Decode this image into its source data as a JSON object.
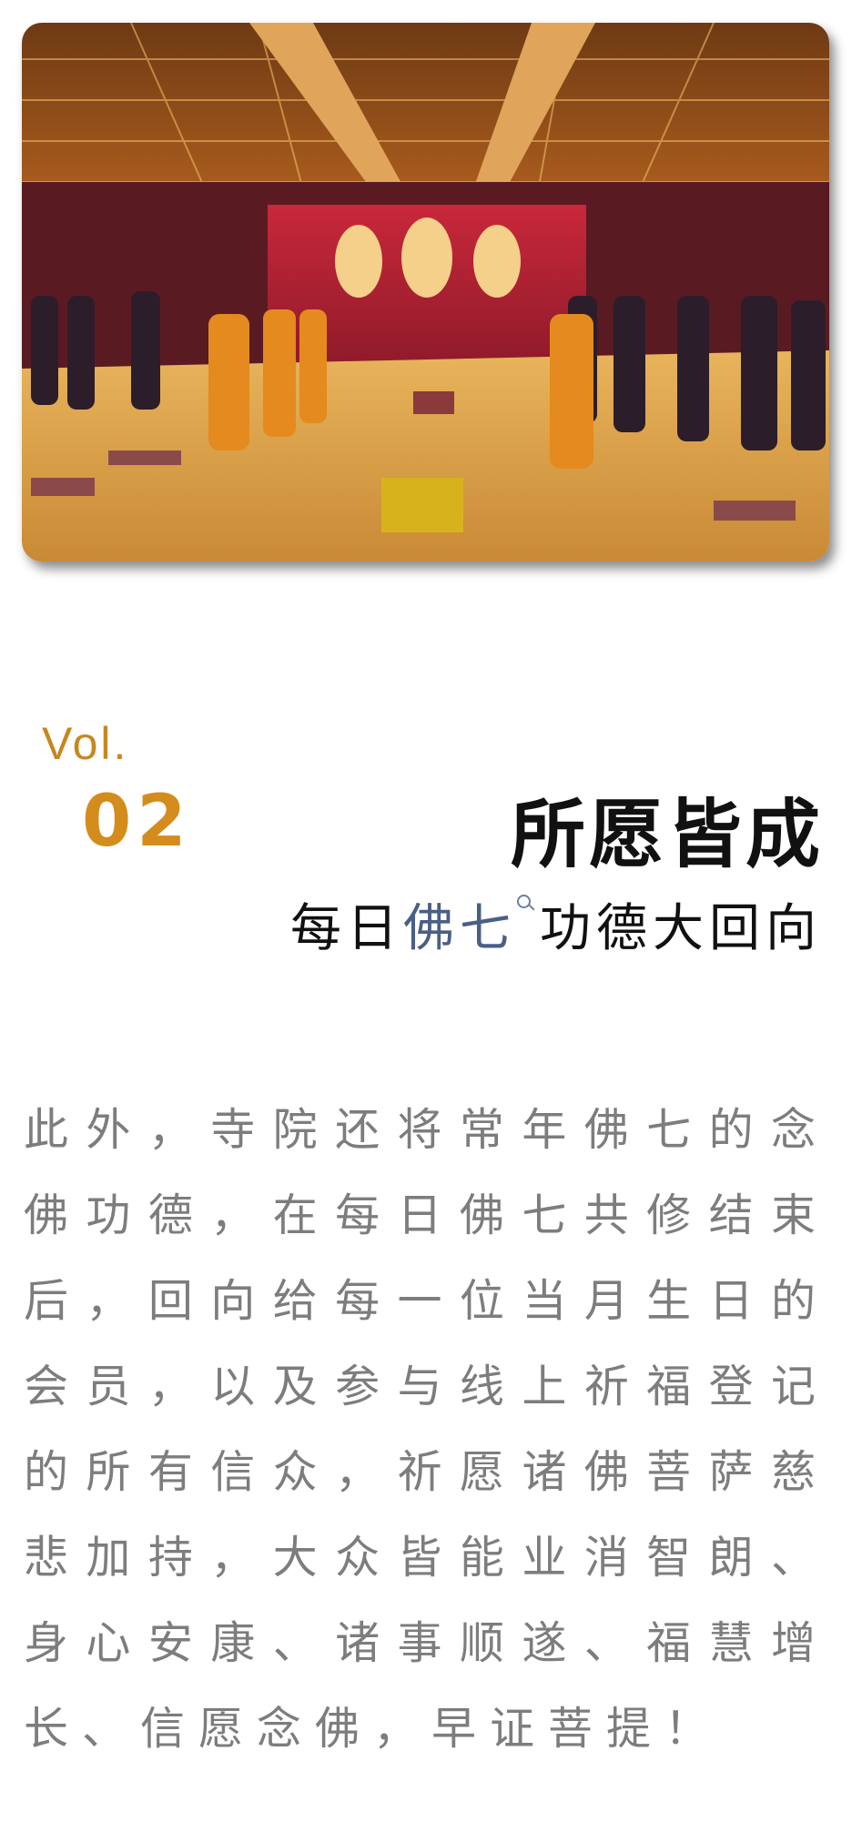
{
  "photo": {
    "alt_icon": "temple-hall-photo"
  },
  "header": {
    "vol_label": "Vol.",
    "vol_number": "02",
    "title": "所愿皆成",
    "subtitle_before": "每日",
    "subtitle_link": "佛七",
    "subtitle_after": "功德大回向"
  },
  "article": {
    "paragraph": "此外，寺院还将常年佛七的念佛功德，在每日佛七共修结束后，回向给每一位当月生日的会员，以及参与线上祈福登记的所有信众，祈愿诸佛菩萨慈悲加持，大众皆能业消智朗、身心安康、诸事顺遂、福慧增长、信愿念佛，早证菩提！"
  },
  "colors": {
    "accent": "#d48c1d",
    "link": "#4a5f86",
    "body_text": "#7d7d7d",
    "title": "#111111"
  }
}
